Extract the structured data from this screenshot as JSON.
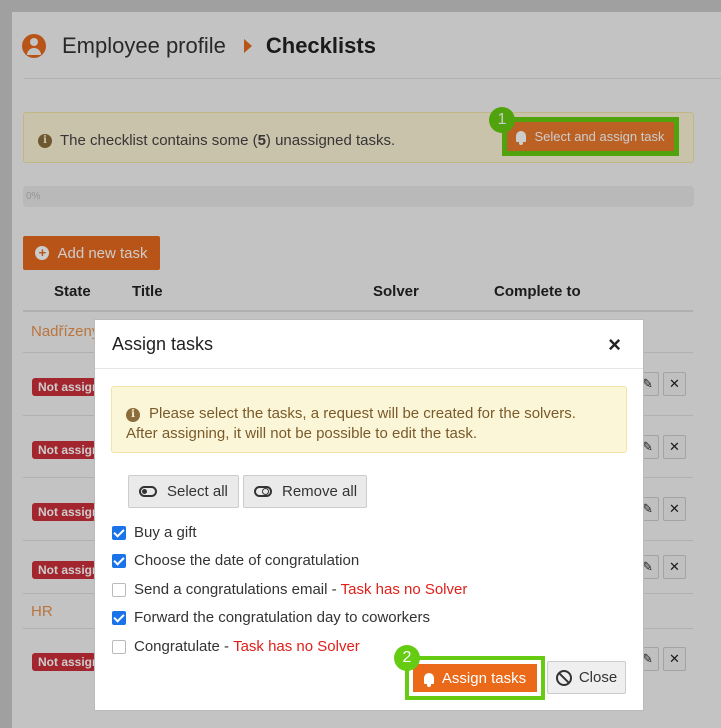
{
  "header": {
    "title": "Employee profile",
    "subtitle": "Checklists"
  },
  "alert": {
    "text_before": "The checklist contains some (",
    "count": "5",
    "text_after": ") unassigned tasks.",
    "button_label": "Select and assign task"
  },
  "progress": {
    "label": "0%",
    "value": 0
  },
  "add_task_label": "Add new task",
  "table": {
    "columns": [
      "State",
      "Title",
      "Solver",
      "Complete to"
    ]
  },
  "groups": [
    "Nadřízený",
    "HR"
  ],
  "row_badge": "Not assigned",
  "annotations": [
    "1",
    "2"
  ],
  "modal": {
    "title": "Assign tasks",
    "close_symbol": "×",
    "info_line1": "Please select the tasks, a request will be created for the solvers.",
    "info_line2": "After assigning, it will not be possible to edit the task.",
    "select_all_label": "Select all",
    "remove_all_label": "Remove all",
    "tasks": [
      {
        "label": "Buy a gift",
        "checked": true,
        "note": ""
      },
      {
        "label": "Choose the date of congratulation",
        "checked": true,
        "note": ""
      },
      {
        "label": "Send a congratulations email - ",
        "checked": false,
        "note": "Task has no Solver"
      },
      {
        "label": "Forward the congratulation day to coworkers",
        "checked": true,
        "note": ""
      },
      {
        "label": "Congratulate - ",
        "checked": false,
        "note": "Task has no Solver"
      }
    ],
    "assign_label": "Assign tasks",
    "close_label": "Close"
  },
  "colors": {
    "accent": "#e86a1e",
    "highlight": "#66cc11",
    "danger": "#cc2f3a",
    "checkbox": "#1a73e8"
  },
  "icons": [
    "user-circle-icon",
    "caret-right-icon",
    "info-icon",
    "bell-icon",
    "plus-icon",
    "pencil-icon",
    "close-icon",
    "toggle-on-icon",
    "toggle-off-icon",
    "ban-icon"
  ]
}
